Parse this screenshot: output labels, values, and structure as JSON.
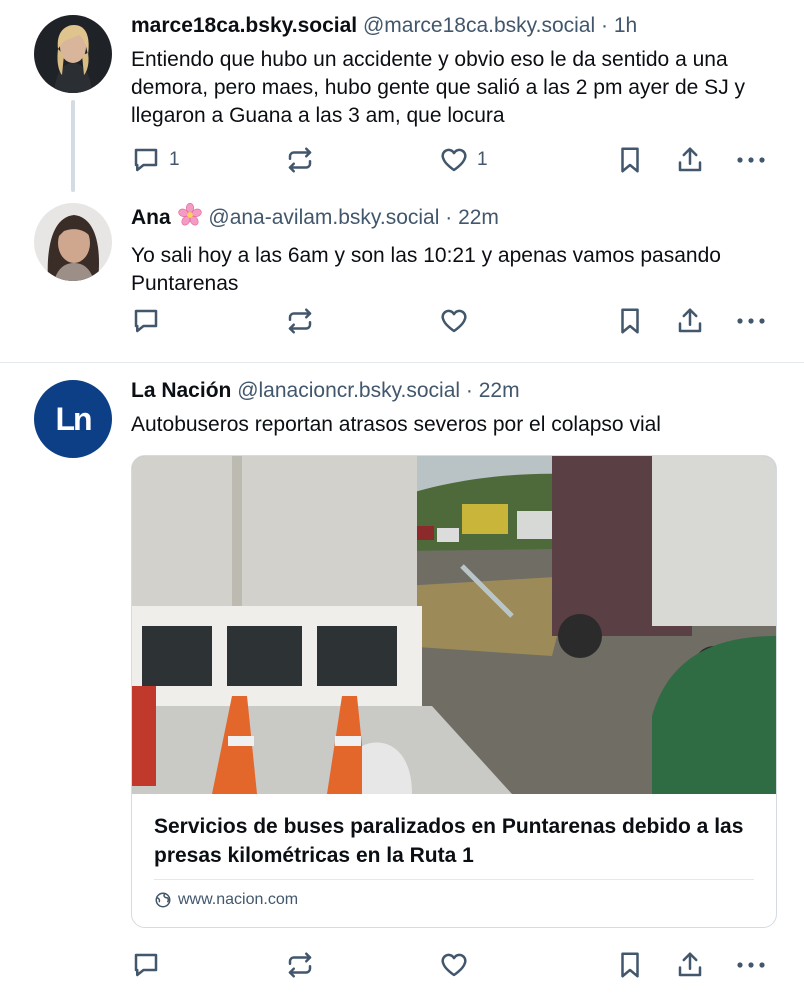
{
  "posts": [
    {
      "display_name": "marce18ca.bsky.social",
      "handle": "@marce18ca.bsky.social",
      "separator": "·",
      "time": "1h",
      "text": "Entiendo que hubo un accidente y obvio eso le da sentido a una demora, pero maes, hubo gente que salió a las 2 pm ayer de SJ y llegaron a Guana a las 3 am, que locura",
      "reply_count": "1",
      "like_count": "1"
    },
    {
      "display_name": "Ana",
      "handle": "@ana-avilam.bsky.social",
      "separator": "·",
      "time": "22m",
      "text": "Yo sali hoy a las 6am y son las 10:21 y apenas vamos pasando Puntarenas",
      "emoji": "cherry-blossom-icon"
    },
    {
      "display_name": "La Nación",
      "handle": "@lanacioncr.bsky.social",
      "separator": "·",
      "time": "22m",
      "text": "Autobuseros reportan atrasos severos por el colapso vial",
      "avatar_text": "Ln",
      "embed": {
        "title": "Servicios de buses paralizados en Puntarenas debido a las presas kilométricas en la Ruta 1",
        "domain": "www.nacion.com"
      }
    }
  ],
  "colors": {
    "text": "#0b0f14",
    "muted": "#42576c",
    "border": "#d4dbe2",
    "nacion_blue": "#0c3f86"
  }
}
